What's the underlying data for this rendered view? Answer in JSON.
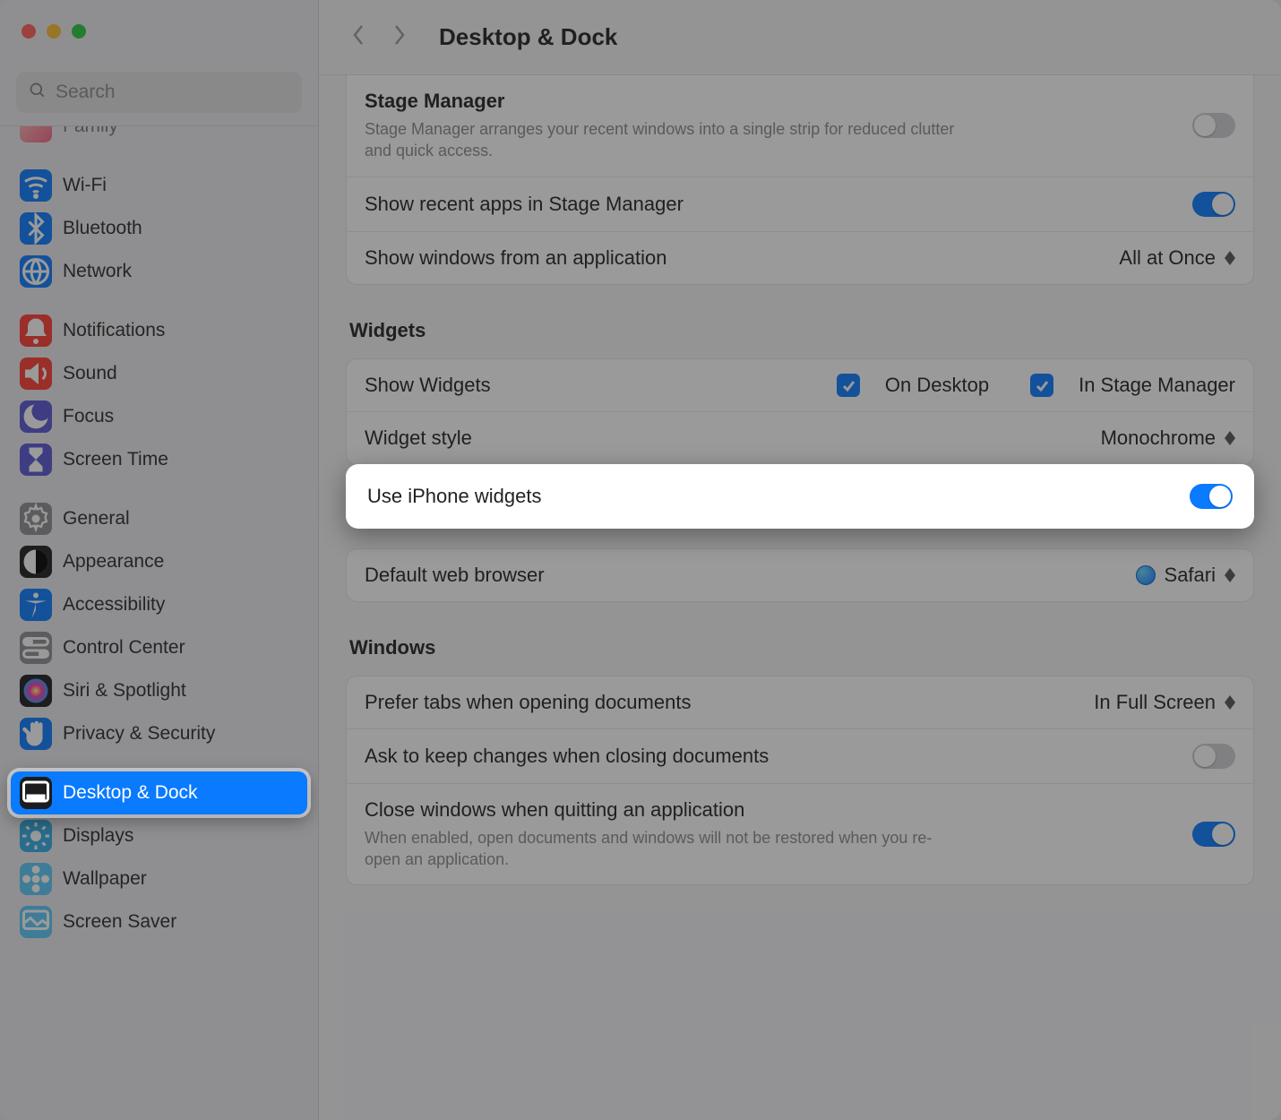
{
  "search": {
    "placeholder": "Search"
  },
  "header": {
    "title": "Desktop & Dock"
  },
  "sidebar": {
    "clipped": "Family",
    "items": [
      {
        "label": "Wi-Fi",
        "icon": "wifi",
        "bg": "bg-blue"
      },
      {
        "label": "Bluetooth",
        "icon": "bluetooth",
        "bg": "bg-blue"
      },
      {
        "label": "Network",
        "icon": "globe",
        "bg": "bg-blue"
      },
      {
        "label": "Notifications",
        "icon": "bell",
        "bg": "bg-red"
      },
      {
        "label": "Sound",
        "icon": "speaker",
        "bg": "bg-red"
      },
      {
        "label": "Focus",
        "icon": "moon",
        "bg": "bg-purple"
      },
      {
        "label": "Screen Time",
        "icon": "hourglass",
        "bg": "bg-purple"
      },
      {
        "label": "General",
        "icon": "gear",
        "bg": "bg-gray"
      },
      {
        "label": "Appearance",
        "icon": "contrast",
        "bg": "bg-black"
      },
      {
        "label": "Accessibility",
        "icon": "accessibility",
        "bg": "bg-blue"
      },
      {
        "label": "Control Center",
        "icon": "switches",
        "bg": "bg-gray"
      },
      {
        "label": "Siri & Spotlight",
        "icon": "siri",
        "bg": "bg-black"
      },
      {
        "label": "Privacy & Security",
        "icon": "hand",
        "bg": "bg-blue"
      },
      {
        "label": "Desktop & Dock",
        "icon": "dock",
        "bg": "bg-black",
        "selected": true
      },
      {
        "label": "Displays",
        "icon": "sun",
        "bg": "bg-cyan"
      },
      {
        "label": "Wallpaper",
        "icon": "flower",
        "bg": "bg-teal"
      },
      {
        "label": "Screen Saver",
        "icon": "screensaver",
        "bg": "bg-teal"
      }
    ]
  },
  "stage": {
    "title": "Stage Manager",
    "desc": "Stage Manager arranges your recent windows into a single strip for reduced clutter and quick access.",
    "recent_label": "Show recent apps in Stage Manager",
    "windows_label": "Show windows from an application",
    "windows_value": "All at Once"
  },
  "widgets": {
    "section": "Widgets",
    "show_label": "Show Widgets",
    "on_desktop": "On Desktop",
    "in_stage": "In Stage Manager",
    "style_label": "Widget style",
    "style_value": "Monochrome",
    "iphone_label": "Use iPhone widgets"
  },
  "browser": {
    "label": "Default web browser",
    "value": "Safari"
  },
  "windows": {
    "section": "Windows",
    "tabs_label": "Prefer tabs when opening documents",
    "tabs_value": "In Full Screen",
    "ask_label": "Ask to keep changes when closing documents",
    "close_label": "Close windows when quitting an application",
    "close_desc": "When enabled, open documents and windows will not be restored when you re-open an application."
  }
}
